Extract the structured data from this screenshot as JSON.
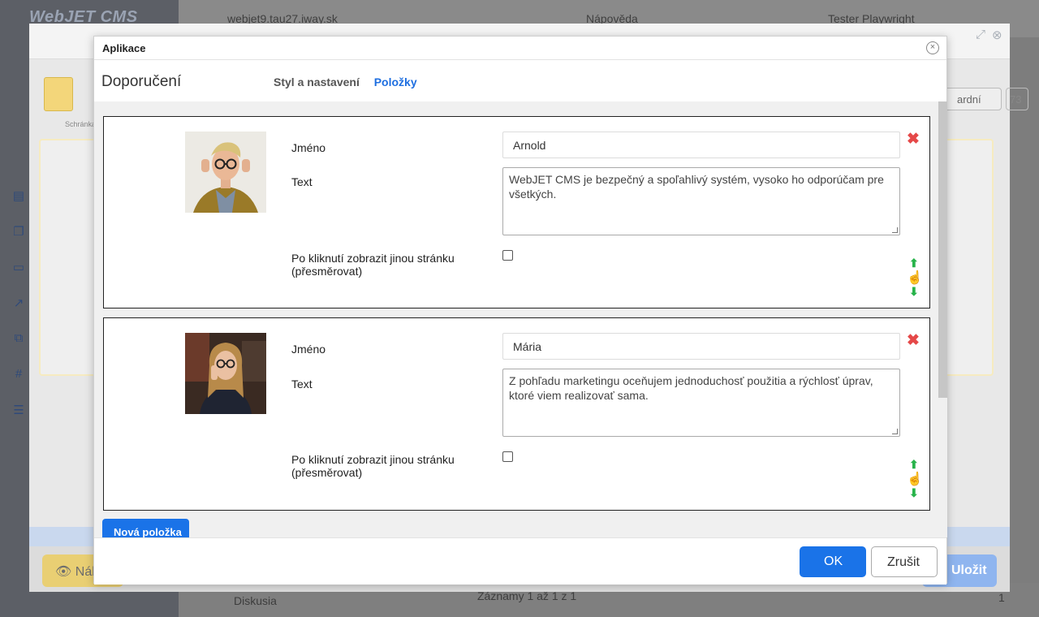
{
  "background": {
    "logo": "WebJET CMS",
    "domain": "webjet9.tau27.iway.sk",
    "help": "Nápověda",
    "user": "Tester Playwright",
    "footer_records": "Záznamy 1 až 1 z 1",
    "footer_page": "1",
    "tree_item": "Diskusia"
  },
  "outer": {
    "clipboard_label": "Schránka",
    "select_value": "ardní",
    "select_number": "73",
    "preview_label": "Náh",
    "save_label": "Uložit"
  },
  "modal": {
    "title": "Aplikace",
    "app_name": "Doporučení",
    "tabs": [
      {
        "label": "Styl a nastavení",
        "active": false
      },
      {
        "label": "Položky",
        "active": true
      }
    ],
    "items": [
      {
        "name_label": "Jméno",
        "name_value": "Arnold",
        "text_label": "Text",
        "text_value": "WebJET CMS je bezpečný a spoľahlivý systém, vysoko ho odporúčam pre všetkých.",
        "redirect_label": "Po kliknutí zobrazit jinou stránku (přesměrovat)",
        "redirect_checked": false
      },
      {
        "name_label": "Jméno",
        "name_value": "Mária",
        "text_label": "Text",
        "text_value": "Z pohľadu marketingu oceňujem jednoduchosť použitia a rýchlosť úprav, ktoré viem realizovať sama.",
        "redirect_label": "Po kliknutí zobrazit jinou stránku (přesměrovat)",
        "redirect_checked": false
      }
    ],
    "new_item_label": "Nová položka",
    "ok_label": "OK",
    "cancel_label": "Zrušit"
  },
  "colors": {
    "primary": "#1a73e8",
    "delete": "#e54848",
    "move_arrows": "#27b34a"
  }
}
